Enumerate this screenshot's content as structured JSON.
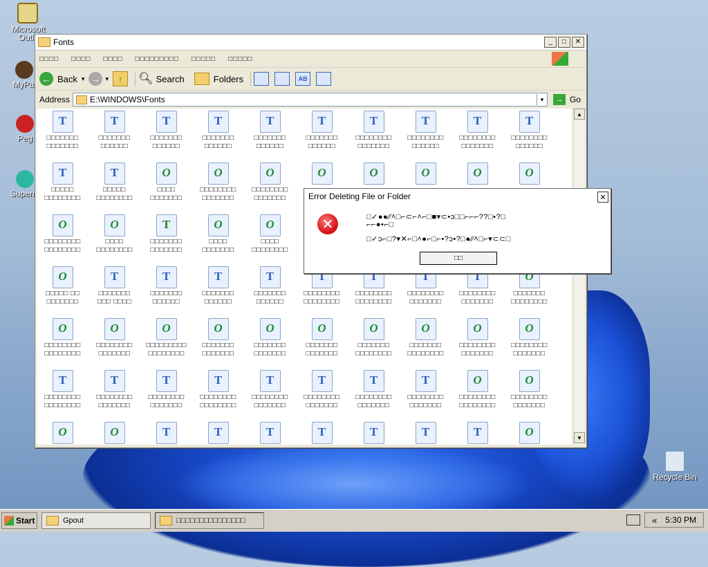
{
  "desktop": {
    "icons": [
      {
        "label": "Microsoft Outlo",
        "id": "outlook"
      },
      {
        "label": "MyPal",
        "id": "mypal"
      },
      {
        "label": "Peg",
        "id": "peg"
      },
      {
        "label": "Superm",
        "id": "superm"
      },
      {
        "label": "Recycle Bin",
        "id": "recycle-bin"
      }
    ]
  },
  "window": {
    "title": "Fonts",
    "menu": [
      "□□□□",
      "□□□□",
      "□□□□",
      "□□□□□□□□□",
      "□□□□□",
      "□□□□□"
    ],
    "toolbar": {
      "back": "Back",
      "search": "Search",
      "folders": "Folders"
    },
    "address": {
      "label": "Address",
      "path": "E:\\WINDOWS\\Fonts",
      "go": "Go"
    },
    "files": [
      {
        "type": "tt",
        "n1": "□□□□□□□",
        "n2": "□□□□□□□"
      },
      {
        "type": "tt",
        "n1": "□□□□□□□",
        "n2": "□□□□□□"
      },
      {
        "type": "tt",
        "n1": "□□□□□□□",
        "n2": "□□□□□□"
      },
      {
        "type": "tt",
        "n1": "□□□□□□□",
        "n2": "□□□□□□"
      },
      {
        "type": "tt",
        "n1": "□□□□□□□",
        "n2": "□□□□□□"
      },
      {
        "type": "tt",
        "n1": "□□□□□□□",
        "n2": "□□□□□□"
      },
      {
        "type": "tt",
        "n1": "□□□□□□□□",
        "n2": "□□□□□□□"
      },
      {
        "type": "tt",
        "n1": "□□□□□□□□",
        "n2": "□□□□□□"
      },
      {
        "type": "tt",
        "n1": "□□□□□□□□",
        "n2": "□□□□□□□"
      },
      {
        "type": "tt",
        "n1": "□□□□□□□□",
        "n2": "□□□□□□"
      },
      {
        "type": "tt",
        "n1": "□□□□□",
        "n2": "□□□□□□□□"
      },
      {
        "type": "tt",
        "n1": "□□□□□",
        "n2": "□□□□□□□□"
      },
      {
        "type": "ot",
        "n1": "□□□□",
        "n2": "□□□□□□□"
      },
      {
        "type": "ot",
        "n1": "□□□□□□□□",
        "n2": "□□□□□□□"
      },
      {
        "type": "ot",
        "n1": "□□□□□□□□",
        "n2": "□□□□□□□"
      },
      {
        "type": "ot",
        "n1": "",
        "n2": ""
      },
      {
        "type": "ot",
        "n1": "",
        "n2": ""
      },
      {
        "type": "ot",
        "n1": "",
        "n2": ""
      },
      {
        "type": "ot",
        "n1": "",
        "n2": ""
      },
      {
        "type": "ot",
        "n1": "",
        "n2": ""
      },
      {
        "type": "ot",
        "n1": "□□□□□□□□",
        "n2": "□□□□□□□□"
      },
      {
        "type": "ot",
        "n1": "□□□□",
        "n2": "□□□□□□□□"
      },
      {
        "type": "rs",
        "n1": "□□□□□□□",
        "n2": "□□□□□□□"
      },
      {
        "type": "ot",
        "n1": "□□□□",
        "n2": "□□□□□□□"
      },
      {
        "type": "ot",
        "n1": "□□□□",
        "n2": "□□□□□□□□"
      },
      {
        "type": "ot",
        "n1": "",
        "n2": ""
      },
      {
        "type": "ot",
        "n1": "",
        "n2": ""
      },
      {
        "type": "ot",
        "n1": "",
        "n2": ""
      },
      {
        "type": "ot",
        "n1": "",
        "n2": ""
      },
      {
        "type": "ot",
        "n1": "",
        "n2": ""
      },
      {
        "type": "ot",
        "n1": "□□□□□ □□",
        "n2": "□□□□□□□"
      },
      {
        "type": "tt",
        "n1": "□□□□□□□",
        "n2": "□□□ □□□□"
      },
      {
        "type": "tt",
        "n1": "□□□□□□□",
        "n2": "□□□□□□"
      },
      {
        "type": "tt",
        "n1": "□□□□□□□",
        "n2": "□□□□□□"
      },
      {
        "type": "tt",
        "n1": "□□□□□□□",
        "n2": "□□□□□□"
      },
      {
        "type": "tt",
        "n1": "□□□□□□□□",
        "n2": "□□□□□□□□"
      },
      {
        "type": "tt",
        "n1": "□□□□□□□□",
        "n2": "□□□□□□□□"
      },
      {
        "type": "tt",
        "n1": "□□□□□□□□",
        "n2": "□□□□□□□"
      },
      {
        "type": "tt",
        "n1": "□□□□□□□□",
        "n2": "□□□□□□□"
      },
      {
        "type": "ot",
        "n1": "□□□□□□□",
        "n2": "□□□□□□□□"
      },
      {
        "type": "ot",
        "n1": "□□□□□□□□",
        "n2": "□□□□□□□□"
      },
      {
        "type": "ot",
        "n1": "□□□□□□□□",
        "n2": "□□□□□□□"
      },
      {
        "type": "ot",
        "n1": "□□□□□□□□□",
        "n2": "□□□□□□□□"
      },
      {
        "type": "ot",
        "n1": "□□□□□□□",
        "n2": "□□□□□□□"
      },
      {
        "type": "ot",
        "n1": "□□□□□□□",
        "n2": "□□□□□□□"
      },
      {
        "type": "ot",
        "n1": "□□□□□□□",
        "n2": "□□□□□□□"
      },
      {
        "type": "ot",
        "n1": "□□□□□□□",
        "n2": "□□□□□□□□"
      },
      {
        "type": "ot",
        "n1": "□□□□□□□",
        "n2": "□□□□□□□□"
      },
      {
        "type": "ot",
        "n1": "□□□□□□□□",
        "n2": "□□□□□□□"
      },
      {
        "type": "ot",
        "n1": "□□□□□□□□",
        "n2": "□□□□□□□"
      },
      {
        "type": "tt",
        "n1": "□□□□□□□□",
        "n2": "□□□□□□□□"
      },
      {
        "type": "tt",
        "n1": "□□□□□□□□",
        "n2": "□□□□□□□"
      },
      {
        "type": "tt",
        "n1": "□□□□□□□□",
        "n2": "□□□□□□□"
      },
      {
        "type": "tt",
        "n1": "□□□□□□□□",
        "n2": "□□□□□□□□"
      },
      {
        "type": "tt",
        "n1": "□□□□□□□□",
        "n2": "□□□□□□□"
      },
      {
        "type": "tt",
        "n1": "□□□□□□□□",
        "n2": "□□□□□□□"
      },
      {
        "type": "tt",
        "n1": "□□□□□□□□",
        "n2": "□□□□□□□"
      },
      {
        "type": "tt",
        "n1": "□□□□□□□□",
        "n2": "□□□□□□□"
      },
      {
        "type": "ot",
        "n1": "□□□□□□□□",
        "n2": "□□□□□□□□"
      },
      {
        "type": "ot",
        "n1": "□□□□□□□□",
        "n2": "□□□□□□□"
      },
      {
        "type": "ot",
        "n1": "",
        "n2": ""
      },
      {
        "type": "ot",
        "n1": "",
        "n2": ""
      },
      {
        "type": "tt",
        "n1": "",
        "n2": ""
      },
      {
        "type": "tt",
        "n1": "",
        "n2": ""
      },
      {
        "type": "tt",
        "n1": "",
        "n2": ""
      },
      {
        "type": "tt",
        "n1": "",
        "n2": ""
      },
      {
        "type": "tt",
        "n1": "",
        "n2": ""
      },
      {
        "type": "tt",
        "n1": "",
        "n2": ""
      },
      {
        "type": "tt",
        "n1": "",
        "n2": ""
      },
      {
        "type": "ot",
        "n1": "",
        "n2": ""
      }
    ]
  },
  "dialog": {
    "title": "Error Deleting File or Folder",
    "line1": "□✓●●⁄⁄˄□⌐⊂⌐˄⌐□■▾⊂•ↄ□□⌐⌐⌐??□•?□",
    "line1b": "⌐⌐●•⌐□",
    "line2": "□✓ↄ⌐□?▾✕⌐□˄●⌐□⌐•?ↄ•?□●⁄⁄˄□⌐▾⊂⊂□",
    "ok": "□□"
  },
  "taskbar": {
    "start": "Start",
    "tasks": [
      {
        "label": "Gpout",
        "active": false
      },
      {
        "label": "□□□□□□□□□□□□□□□",
        "active": true
      }
    ],
    "tray_arrow": "«",
    "clock": "5:30 PM"
  },
  "colors": {
    "error": "#d8181a",
    "link": "#2a5fb7",
    "opentype": "#1f8a33"
  }
}
